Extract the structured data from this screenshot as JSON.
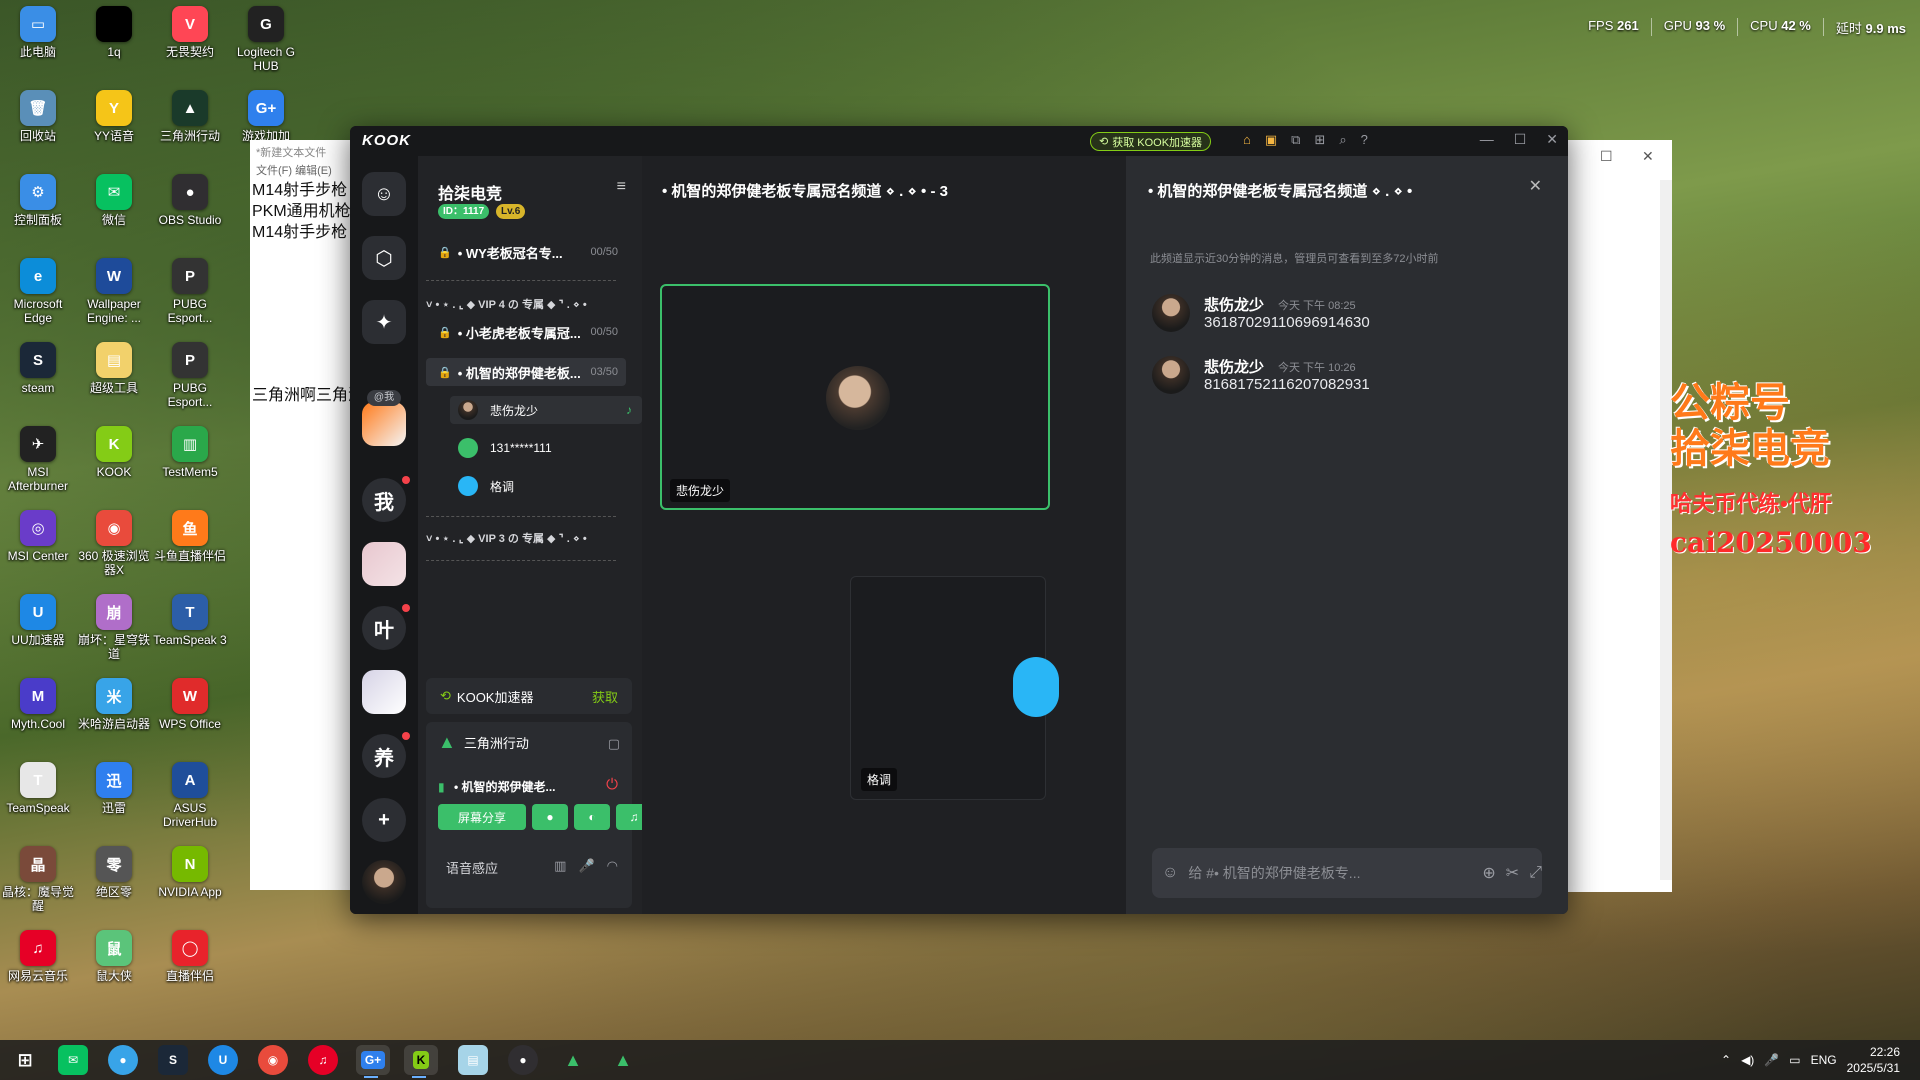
{
  "perf": {
    "fps_label": "FPS",
    "fps_value": "261",
    "gpu_label": "GPU",
    "gpu_value": "93 %",
    "cpu_label": "CPU",
    "cpu_value": "42 %",
    "lat_label": "延时",
    "lat_value": "9.9 ms"
  },
  "desktop": {
    "icons": [
      {
        "label": "此电脑",
        "glyph": "▭",
        "color": "#3a8ee6"
      },
      {
        "label": "1q",
        "glyph": "",
        "color": "#000000"
      },
      {
        "label": "无畏契约",
        "glyph": "V",
        "color": "#ff4655"
      },
      {
        "label": "Logitech G HUB",
        "glyph": "G",
        "color": "#222222"
      },
      {
        "label": "回收站",
        "glyph": "🗑",
        "color": "#5a8fb8"
      },
      {
        "label": "YY语音",
        "glyph": "Y",
        "color": "#f5c518"
      },
      {
        "label": "三角洲行动",
        "glyph": "▲",
        "color": "#1a3a2a"
      },
      {
        "label": "游戏加加",
        "glyph": "G+",
        "color": "#2f80ed"
      },
      {
        "label": "控制面板",
        "glyph": "⚙",
        "color": "#3a8ee6"
      },
      {
        "label": "微信",
        "glyph": "✉",
        "color": "#07c160"
      },
      {
        "label": "OBS Studio",
        "glyph": "●",
        "color": "#302e31"
      },
      {
        "label": "Microsoft Edge",
        "glyph": "e",
        "color": "#0c8dd9"
      },
      {
        "label": "Wallpaper Engine: ...",
        "glyph": "W",
        "color": "#1e4b9a"
      },
      {
        "label": "PUBG Esport...",
        "glyph": "P",
        "color": "#333333"
      },
      {
        "label": "steam",
        "glyph": "S",
        "color": "#1b2838"
      },
      {
        "label": "超级工具",
        "glyph": "▤",
        "color": "#f2d16b"
      },
      {
        "label": "PUBG Esport...",
        "glyph": "P",
        "color": "#333333"
      },
      {
        "label": "MSI Afterburner",
        "glyph": "✈",
        "color": "#222222"
      },
      {
        "label": "KOOK",
        "glyph": "K",
        "color": "#84cc16"
      },
      {
        "label": "TestMem5",
        "glyph": "▥",
        "color": "#2aa84a"
      },
      {
        "label": "MSI Center",
        "glyph": "◎",
        "color": "#6a3cc9"
      },
      {
        "label": "360 极速浏览器X",
        "glyph": "◉",
        "color": "#e94b3c"
      },
      {
        "label": "斗鱼直播伴侣",
        "glyph": "鱼",
        "color": "#ff7a1a"
      },
      {
        "label": "UU加速器",
        "glyph": "U",
        "color": "#1e88e5"
      },
      {
        "label": "崩坏：星穹铁道",
        "glyph": "崩",
        "color": "#b06ec9"
      },
      {
        "label": "TeamSpeak 3",
        "glyph": "T",
        "color": "#2c5ea8"
      },
      {
        "label": "Myth.Cool",
        "glyph": "M",
        "color": "#4a3cc9"
      },
      {
        "label": "米哈游启动器",
        "glyph": "米",
        "color": "#38a4e8"
      },
      {
        "label": "WPS Office",
        "glyph": "W",
        "color": "#e02b2b"
      },
      {
        "label": "TeamSpeak",
        "glyph": "T",
        "color": "#e7e7e7"
      },
      {
        "label": "迅雷",
        "glyph": "迅",
        "color": "#2f7fef"
      },
      {
        "label": "ASUS DriverHub",
        "glyph": "A",
        "color": "#1f4e9a"
      },
      {
        "label": "晶核：魔导觉醒",
        "glyph": "晶",
        "color": "#7a4a3a"
      },
      {
        "label": "绝区零",
        "glyph": "零",
        "color": "#555555"
      },
      {
        "label": "NVIDIA App",
        "glyph": "N",
        "color": "#76b900"
      },
      {
        "label": "网易云音乐",
        "glyph": "♫",
        "color": "#e60026"
      },
      {
        "label": "鼠大侠",
        "glyph": "鼠",
        "color": "#5bc47a"
      },
      {
        "label": "直播伴侣",
        "glyph": "◯",
        "color": "#e8232b"
      }
    ]
  },
  "notepad": {
    "title": "*新建文本文件",
    "menu": "文件(F)    编辑(E)",
    "lines": [
      "M14射手步枪",
      "PKM通用机枪",
      "M14射手步枪"
    ],
    "extra": "三角洲啊三角洲",
    "side_text": "新建"
  },
  "overlay": {
    "line1": "公粽号",
    "line2": "拾柒电竞",
    "line3": "哈夫币代练•代肝",
    "line4": "cai20250003"
  },
  "kook": {
    "logo": "KOOK",
    "boost_button": "获取 KOOK加速器",
    "guild": {
      "name": "拾柒电竞",
      "id_badge": "ID：1117",
      "level_badge": "Lv.6"
    },
    "rail": {
      "me_tag": "@我",
      "chars": [
        "我",
        "叶",
        "养"
      ]
    },
    "channels": {
      "top_channel": {
        "name": "• WY老板冠名专...",
        "count": "00/50"
      },
      "cat_vip4": "˅ • ⋆ . ⌞ ◆ VIP 4 の 专属 ◆ ⌝ . ⋄ •",
      "ch1": {
        "name": "• 小老虎老板专属冠...",
        "count": "00/50"
      },
      "ch2": {
        "name": "• 机智的郑伊健老板...",
        "count": "03/50"
      },
      "members": [
        "悲伤龙少",
        "131*****111",
        "格调"
      ],
      "cat_vip3": "˅ • ⋆ . ⌞ ◆ VIP 3 の 专属 ◆ ⌝ . ⋄ •"
    },
    "booster": {
      "label": "KOOK加速器",
      "action": "获取"
    },
    "voice": {
      "game": "三角洲行动",
      "channel": "• 机智的郑伊健老...",
      "share_button": "屏幕分享",
      "sense_label": "语音感应"
    },
    "stage": {
      "title": "• 机智的郑伊健老板专属冠名频道 ⋄ . ⋄ • - 3",
      "tile1_name": "悲伤龙少",
      "tile2_name": "格调"
    },
    "chat": {
      "title": "• 机智的郑伊健老板专属冠名频道 ⋄ . ⋄ •",
      "notice": "此频道显示近30分钟的消息，管理员可查看到至多72小时前",
      "messages": [
        {
          "name": "悲伤龙少",
          "time": "今天 下午 08:25",
          "text": "36187029110696914630"
        },
        {
          "name": "悲伤龙少",
          "time": "今天 下午 10:26",
          "text": "81681752116207082931"
        }
      ],
      "input_placeholder": "给 #• 机智的郑伊健老板专..."
    }
  },
  "taskbar": {
    "lang": "ENG",
    "time": "22:26",
    "date": "2025/5/31"
  }
}
